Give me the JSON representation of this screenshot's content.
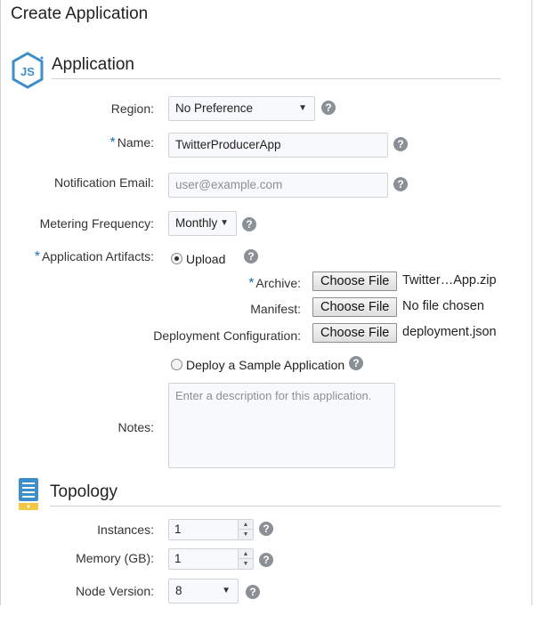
{
  "page": {
    "title": "Create Application"
  },
  "application_section": {
    "title": "Application",
    "icon": "nodejs-icon",
    "region": {
      "label": "Region:",
      "value": "No Preference"
    },
    "name": {
      "required_mark": "*",
      "label": "Name:",
      "value": "TwitterProducerApp"
    },
    "notification_email": {
      "label": "Notification Email:",
      "placeholder": "user@example.com"
    },
    "metering_frequency": {
      "label": "Metering Frequency:",
      "value": "Monthly"
    },
    "artifacts": {
      "required_mark": "*",
      "label": "Application Artifacts:",
      "upload_label": "Upload",
      "upload_selected": true,
      "archive": {
        "required_mark": "*",
        "label": "Archive:",
        "button": "Choose File",
        "file": "Twitter…App.zip"
      },
      "manifest": {
        "label": "Manifest:",
        "button": "Choose File",
        "file": "No file chosen"
      },
      "deployment": {
        "label": "Deployment Configuration:",
        "button": "Choose File",
        "file": "deployment.json"
      },
      "sample_label": "Deploy a Sample Application",
      "sample_selected": false
    },
    "notes": {
      "label": "Notes:",
      "placeholder": "Enter a description for this application."
    }
  },
  "topology_section": {
    "title": "Topology",
    "icon": "server-icon",
    "instances": {
      "label": "Instances:",
      "value": "1"
    },
    "memory": {
      "label": "Memory (GB):",
      "value": "1"
    },
    "node_version": {
      "label": "Node Version:",
      "value": "8"
    }
  },
  "help_glyph": "?",
  "colors": {
    "accent": "#1a6fb5",
    "help": "#8a9096",
    "field_bg": "#f7f9fb",
    "border": "#cfd4d8"
  }
}
